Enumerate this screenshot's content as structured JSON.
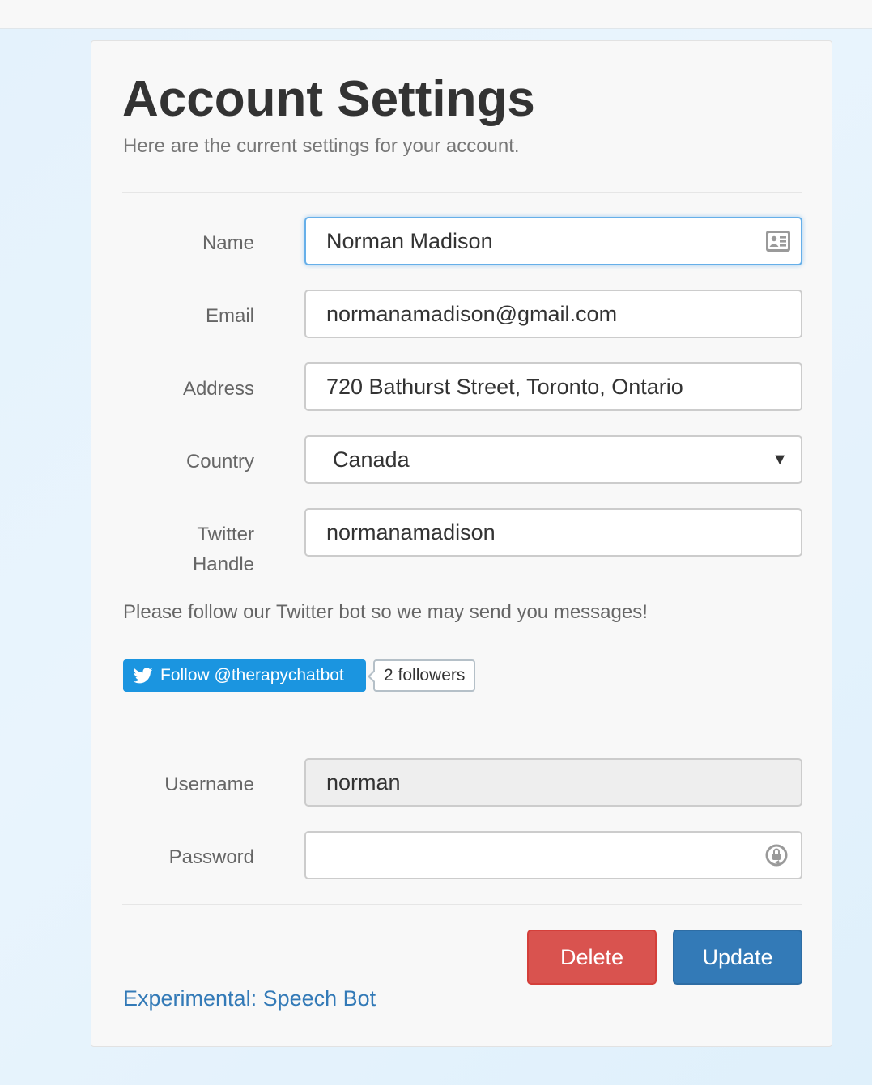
{
  "page": {
    "title": "Account Settings",
    "subtitle": "Here are the current settings for your account."
  },
  "form": {
    "name": {
      "label": "Name",
      "value": "Norman Madison"
    },
    "email": {
      "label": "Email",
      "value": "normanamadison@gmail.com"
    },
    "address": {
      "label": "Address",
      "value": "720 Bathurst Street, Toronto, Ontario"
    },
    "country": {
      "label": "Country",
      "value": "Canada"
    },
    "twitter": {
      "label_line1": "Twitter",
      "label_line2": "Handle",
      "value": "normanamadison"
    },
    "username": {
      "label": "Username",
      "value": "norman"
    },
    "password": {
      "label": "Password",
      "value": ""
    }
  },
  "twitter_section": {
    "note": "Please follow our Twitter bot so we may send you messages!",
    "follow_label": "Follow @therapychatbot",
    "followers_label": "2 followers"
  },
  "actions": {
    "delete_label": "Delete",
    "update_label": "Update",
    "speech_bot_link": "Experimental: Speech Bot"
  },
  "colors": {
    "accent": "#337ab7",
    "danger": "#d9534f",
    "twitter": "#1b95e0",
    "focus": "#66afe9"
  },
  "icons": {
    "name_field": "contact-card-icon",
    "country_select": "caret-down-icon",
    "password_field": "password-manager-icon",
    "follow_button": "twitter-bird-icon"
  }
}
